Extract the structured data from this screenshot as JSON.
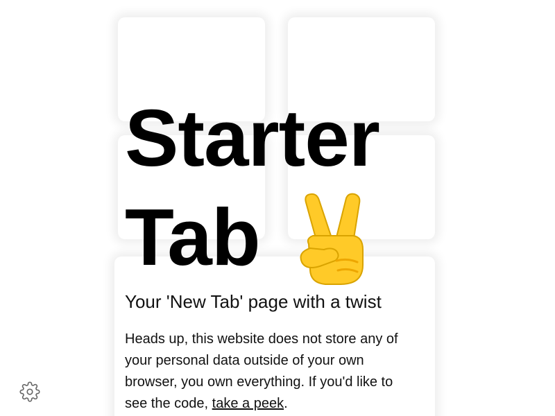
{
  "hero": {
    "title_line1": "Starter",
    "title_line2": "Tab",
    "emoji": "victory-hand-emoji"
  },
  "subtitle": "Your 'New Tab' page with a twist",
  "notice": {
    "text_before": "Heads up, this website does not store any of your personal data outside of your own browser, you own everything. If you'd like to see the code, ",
    "link_text": "take a peek",
    "text_after": "."
  },
  "settings": {
    "icon": "gear-icon",
    "color": "#666666"
  },
  "colors": {
    "emoji_fill": "#FFCA28",
    "emoji_shade": "#EDA600",
    "emoji_outline": "#D9A300"
  }
}
